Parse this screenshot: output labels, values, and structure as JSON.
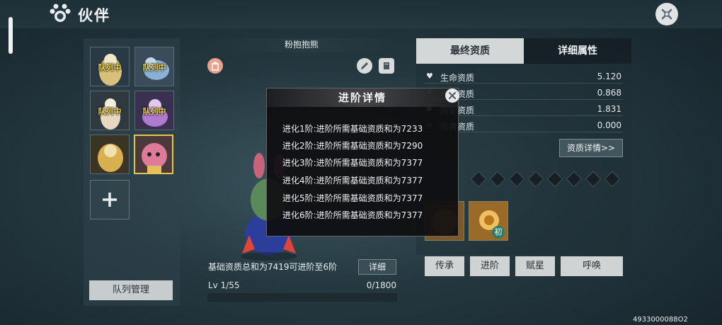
{
  "header": {
    "title": "伙伴"
  },
  "roster": {
    "slots": [
      {
        "tag": "队列中",
        "color": "#d8c07a"
      },
      {
        "tag": "队列中",
        "color": "#8ab0d8"
      },
      {
        "tag": "队列中",
        "color": "#e8d8c0"
      },
      {
        "tag": "队列中",
        "color": "#b07ad0"
      },
      {
        "tag": "",
        "color": "#d8b050"
      },
      {
        "tag": "",
        "color": "#e07a9a"
      }
    ],
    "queue_button": "队列管理"
  },
  "pet": {
    "name": "粉抱抱熊",
    "base_stat_text": "基础资质总和为7419可进阶至6阶",
    "detail_button": "详细",
    "level": "Lv 1/55",
    "exp": "0/1800",
    "exp_fraction": 0.0
  },
  "tabs": {
    "final": "最终资质",
    "detail": "详细属性"
  },
  "attributes": [
    {
      "name": "生命资质",
      "value": "5.120"
    },
    {
      "name": "攻击资质",
      "value": "0.868"
    },
    {
      "name": "防御资质",
      "value": "1.831"
    },
    {
      "name": "伤害资质",
      "value": "0.000"
    }
  ],
  "attr_detail_button": "资质详情>>",
  "skill_badge": "初",
  "actions": [
    {
      "label": "传承"
    },
    {
      "label": "进阶"
    },
    {
      "label": "赋星"
    },
    {
      "label": "呼唤"
    }
  ],
  "uid": "4933000088O2",
  "modal": {
    "title": "进阶详情",
    "lines": [
      "进化1阶:进阶所需基础资质和为7233",
      "进化2阶:进阶所需基础资质和为7290",
      "进化3阶:进阶所需基础资质和为7377",
      "进化4阶:进阶所需基础资质和为7377",
      "进化5阶:进阶所需基础资质和为7377",
      "进化6阶:进阶所需基础资质和为7377"
    ]
  }
}
